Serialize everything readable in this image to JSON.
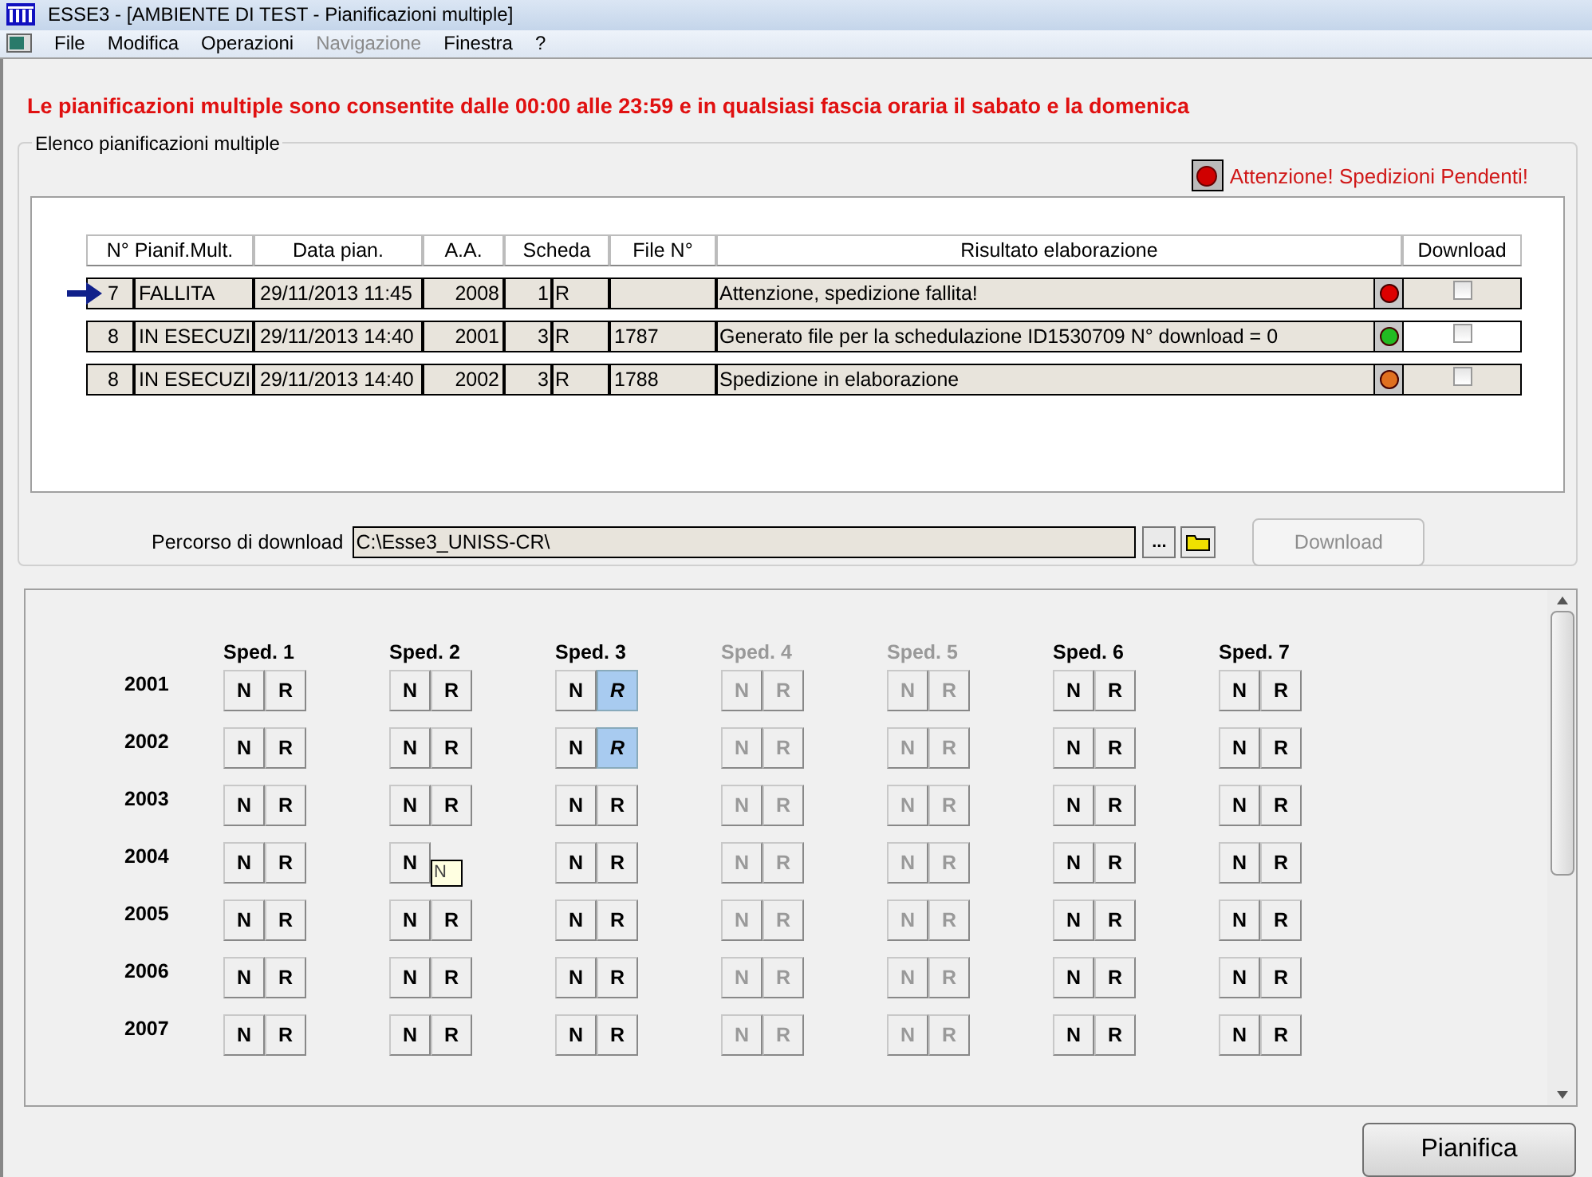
{
  "window": {
    "title": "ESSE3 - [AMBIENTE DI TEST - Pianificazioni multiple]"
  },
  "menu": [
    {
      "label": "File",
      "disabled": false
    },
    {
      "label": "Modifica",
      "disabled": false
    },
    {
      "label": "Operazioni",
      "disabled": false
    },
    {
      "label": "Navigazione",
      "disabled": true
    },
    {
      "label": "Finestra",
      "disabled": false
    },
    {
      "label": "?",
      "disabled": false
    }
  ],
  "notice": "Le pianificazioni multiple sono consentite dalle 00:00 alle 23:59 e in qualsiasi fascia oraria il sabato e la domenica",
  "group": {
    "title": "Elenco pianificazioni multiple",
    "alert": "Attenzione! Spedizioni Pendenti!",
    "table": {
      "columns": [
        "N° Pianif.Mult.",
        "Data pian.",
        "A.A.",
        "Scheda",
        "File N°",
        "Risultato elaborazione",
        "Download"
      ],
      "rows": [
        {
          "current": true,
          "number": "7",
          "state": "FALLITA",
          "date": "29/11/2013 11:45",
          "year": "2008",
          "card": "1",
          "card_type": "R",
          "file": "",
          "result": "Attenzione, spedizione fallita!",
          "color": "#dd0000",
          "checked": false,
          "download_enabled": false
        },
        {
          "current": false,
          "number": "8",
          "state": "IN ESECUZI",
          "date": "29/11/2013 14:40",
          "year": "2001",
          "card": "3",
          "card_type": "R",
          "file": "1787",
          "result": "Generato file per la schedulazione ID1530709 N° download = 0",
          "color": "#22bb22",
          "checked": false,
          "download_enabled": true
        },
        {
          "current": false,
          "number": "8",
          "state": "IN ESECUZI",
          "date": "29/11/2013 14:40",
          "year": "2002",
          "card": "3",
          "card_type": "R",
          "file": "1788",
          "result": "Spedizione in elaborazione",
          "color": "#e07020",
          "checked": false,
          "download_enabled": false
        }
      ]
    },
    "path_label": "Percorso di download",
    "path": "C:\\Esse3_UNISS-CR\\",
    "browse": "...",
    "download_button": {
      "label": "Download",
      "disabled": true
    }
  },
  "grid": {
    "columns": [
      {
        "label": "Sped. 1",
        "disabled": false
      },
      {
        "label": "Sped. 2",
        "disabled": false
      },
      {
        "label": "Sped. 3",
        "disabled": false
      },
      {
        "label": "Sped. 4",
        "disabled": true
      },
      {
        "label": "Sped. 5",
        "disabled": true
      },
      {
        "label": "Sped. 6",
        "disabled": false
      },
      {
        "label": "Sped. 7",
        "disabled": false
      }
    ],
    "rows": [
      {
        "year": "2001",
        "cells": [
          [
            {
              "label": "N",
              "selected": false
            },
            {
              "label": "R",
              "selected": false
            }
          ],
          [
            {
              "label": "N",
              "selected": false
            },
            {
              "label": "R",
              "selected": false
            }
          ],
          [
            {
              "label": "N",
              "selected": false
            },
            {
              "label": "R",
              "selected": true
            }
          ],
          [
            {
              "label": "N",
              "selected": false
            },
            {
              "label": "R",
              "selected": false
            }
          ],
          [
            {
              "label": "N",
              "selected": false
            },
            {
              "label": "R",
              "selected": false
            }
          ],
          [
            {
              "label": "N",
              "selected": false
            },
            {
              "label": "R",
              "selected": false
            }
          ],
          [
            {
              "label": "N",
              "selected": false
            },
            {
              "label": "R",
              "selected": false
            }
          ]
        ]
      },
      {
        "year": "2002",
        "cells": [
          [
            {
              "label": "N",
              "selected": false
            },
            {
              "label": "R",
              "selected": false
            }
          ],
          [
            {
              "label": "N",
              "selected": false
            },
            {
              "label": "R",
              "selected": false
            }
          ],
          [
            {
              "label": "N",
              "selected": false
            },
            {
              "label": "R",
              "selected": true
            }
          ],
          [
            {
              "label": "N",
              "selected": false
            },
            {
              "label": "R",
              "selected": false
            }
          ],
          [
            {
              "label": "N",
              "selected": false
            },
            {
              "label": "R",
              "selected": false
            }
          ],
          [
            {
              "label": "N",
              "selected": false
            },
            {
              "label": "R",
              "selected": false
            }
          ],
          [
            {
              "label": "N",
              "selected": false
            },
            {
              "label": "R",
              "selected": false
            }
          ]
        ]
      },
      {
        "year": "2003",
        "cells": [
          [
            {
              "label": "N",
              "selected": false
            },
            {
              "label": "R",
              "selected": false
            }
          ],
          [
            {
              "label": "N",
              "selected": false
            },
            {
              "label": "R",
              "selected": false
            }
          ],
          [
            {
              "label": "N",
              "selected": false
            },
            {
              "label": "R",
              "selected": false
            }
          ],
          [
            {
              "label": "N",
              "selected": false
            },
            {
              "label": "R",
              "selected": false
            }
          ],
          [
            {
              "label": "N",
              "selected": false
            },
            {
              "label": "R",
              "selected": false
            }
          ],
          [
            {
              "label": "N",
              "selected": false
            },
            {
              "label": "R",
              "selected": false
            }
          ],
          [
            {
              "label": "N",
              "selected": false
            },
            {
              "label": "R",
              "selected": false
            }
          ]
        ]
      },
      {
        "year": "2004",
        "cells": [
          [
            {
              "label": "N",
              "selected": false
            },
            {
              "label": "R",
              "selected": false
            }
          ],
          [
            {
              "label": "N",
              "selected": false
            },
            {
              "kind": "tooltip",
              "label": "N"
            }
          ],
          [
            {
              "label": "N",
              "selected": false
            },
            {
              "label": "R",
              "selected": false
            }
          ],
          [
            {
              "label": "N",
              "selected": false
            },
            {
              "label": "R",
              "selected": false
            }
          ],
          [
            {
              "label": "N",
              "selected": false
            },
            {
              "label": "R",
              "selected": false
            }
          ],
          [
            {
              "label": "N",
              "selected": false
            },
            {
              "label": "R",
              "selected": false
            }
          ],
          [
            {
              "label": "N",
              "selected": false
            },
            {
              "label": "R",
              "selected": false
            }
          ]
        ]
      },
      {
        "year": "2005",
        "cells": [
          [
            {
              "label": "N",
              "selected": false
            },
            {
              "label": "R",
              "selected": false
            }
          ],
          [
            {
              "label": "N",
              "selected": false
            },
            {
              "label": "R",
              "selected": false
            }
          ],
          [
            {
              "label": "N",
              "selected": false
            },
            {
              "label": "R",
              "selected": false
            }
          ],
          [
            {
              "label": "N",
              "selected": false
            },
            {
              "label": "R",
              "selected": false
            }
          ],
          [
            {
              "label": "N",
              "selected": false
            },
            {
              "label": "R",
              "selected": false
            }
          ],
          [
            {
              "label": "N",
              "selected": false
            },
            {
              "label": "R",
              "selected": false
            }
          ],
          [
            {
              "label": "N",
              "selected": false
            },
            {
              "label": "R",
              "selected": false
            }
          ]
        ]
      },
      {
        "year": "2006",
        "cells": [
          [
            {
              "label": "N",
              "selected": false
            },
            {
              "label": "R",
              "selected": false
            }
          ],
          [
            {
              "label": "N",
              "selected": false
            },
            {
              "label": "R",
              "selected": false
            }
          ],
          [
            {
              "label": "N",
              "selected": false
            },
            {
              "label": "R",
              "selected": false
            }
          ],
          [
            {
              "label": "N",
              "selected": false
            },
            {
              "label": "R",
              "selected": false
            }
          ],
          [
            {
              "label": "N",
              "selected": false
            },
            {
              "label": "R",
              "selected": false
            }
          ],
          [
            {
              "label": "N",
              "selected": false
            },
            {
              "label": "R",
              "selected": false
            }
          ],
          [
            {
              "label": "N",
              "selected": false
            },
            {
              "label": "R",
              "selected": false
            }
          ]
        ]
      },
      {
        "year": "2007",
        "cells": [
          [
            {
              "label": "N",
              "selected": false
            },
            {
              "label": "R",
              "selected": false
            }
          ],
          [
            {
              "label": "N",
              "selected": false
            },
            {
              "label": "R",
              "selected": false
            }
          ],
          [
            {
              "label": "N",
              "selected": false
            },
            {
              "label": "R",
              "selected": false
            }
          ],
          [
            {
              "label": "N",
              "selected": false
            },
            {
              "label": "R",
              "selected": false
            }
          ],
          [
            {
              "label": "N",
              "selected": false
            },
            {
              "label": "R",
              "selected": false
            }
          ],
          [
            {
              "label": "N",
              "selected": false
            },
            {
              "label": "R",
              "selected": false
            }
          ],
          [
            {
              "label": "N",
              "selected": false
            },
            {
              "label": "R",
              "selected": false
            }
          ]
        ]
      }
    ]
  },
  "action_button": "Pianifica"
}
